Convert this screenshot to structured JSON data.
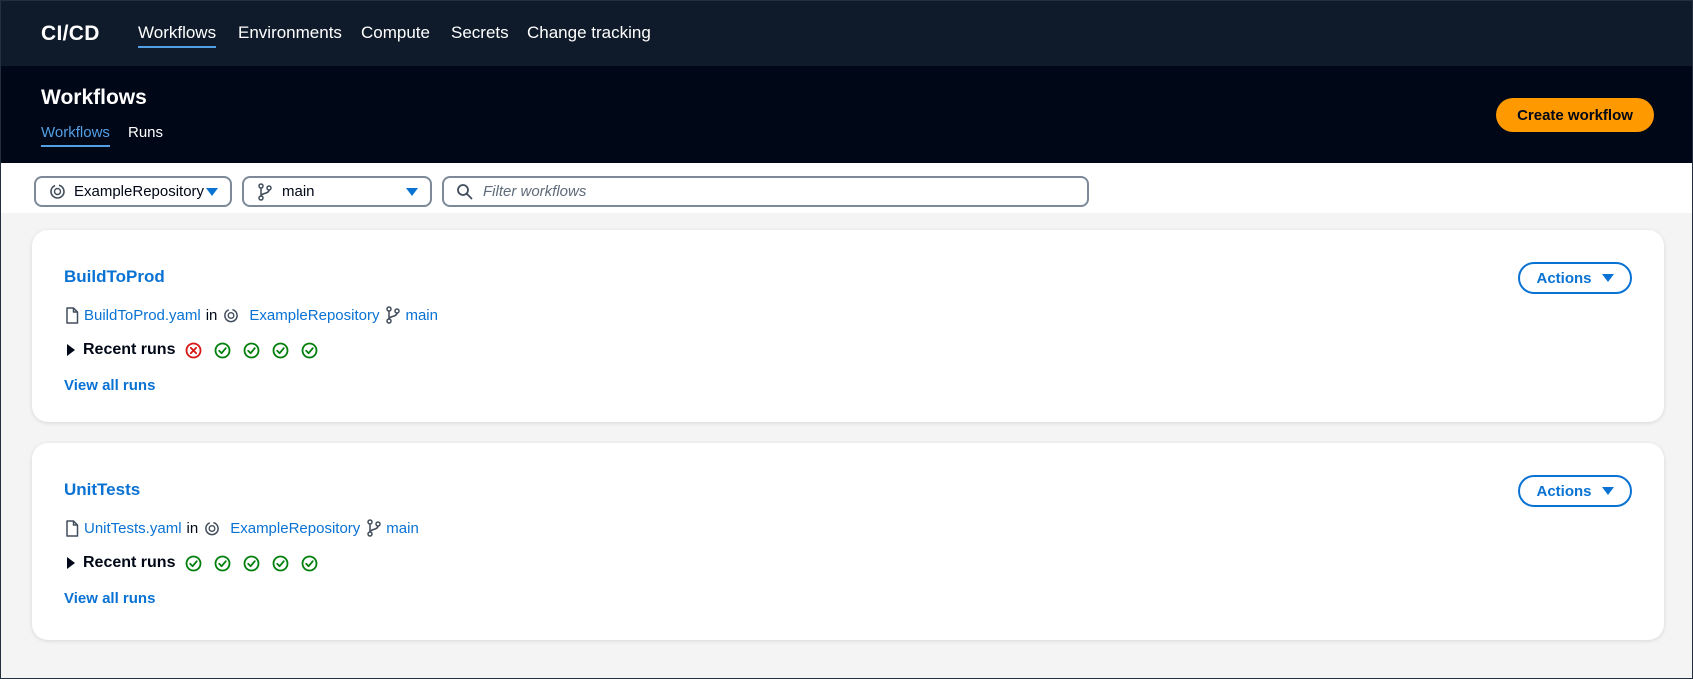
{
  "nav": {
    "brand": "CI/CD",
    "items": [
      {
        "label": "Workflows",
        "active": true
      },
      {
        "label": "Environments",
        "active": false
      },
      {
        "label": "Compute",
        "active": false
      },
      {
        "label": "Secrets",
        "active": false
      },
      {
        "label": "Change tracking",
        "active": false
      }
    ]
  },
  "header": {
    "title": "Workflows",
    "tabs": [
      {
        "label": "Workflows",
        "active": true
      },
      {
        "label": "Runs",
        "active": false
      }
    ],
    "create_button": "Create workflow"
  },
  "filters": {
    "repository": {
      "value": "ExampleRepository",
      "icon": "repository-icon"
    },
    "branch": {
      "value": "main",
      "icon": "branch-icon"
    },
    "search": {
      "placeholder": "Filter workflows",
      "value": ""
    }
  },
  "workflows": [
    {
      "name": "BuildToProd",
      "file": "BuildToProd.yaml",
      "in_text": "in",
      "repository": "ExampleRepository",
      "branch": "main",
      "actions_label": "Actions",
      "recent_runs_label": "Recent runs",
      "recent_runs": [
        "failed",
        "succeeded",
        "succeeded",
        "succeeded",
        "succeeded"
      ],
      "view_all": "View all runs"
    },
    {
      "name": "UnitTests",
      "file": "UnitTests.yaml",
      "in_text": "in",
      "repository": "ExampleRepository",
      "branch": "main",
      "actions_label": "Actions",
      "recent_runs_label": "Recent runs",
      "recent_runs": [
        "succeeded",
        "succeeded",
        "succeeded",
        "succeeded",
        "succeeded"
      ],
      "view_all": "View all runs"
    }
  ],
  "colors": {
    "nav_bg": "#0f1b2a",
    "header_bg": "#000716",
    "link": "#0972d3",
    "accent": "#ff9900",
    "success": "#037f0c",
    "error": "#d91515",
    "active_tab": "#539fe5"
  }
}
